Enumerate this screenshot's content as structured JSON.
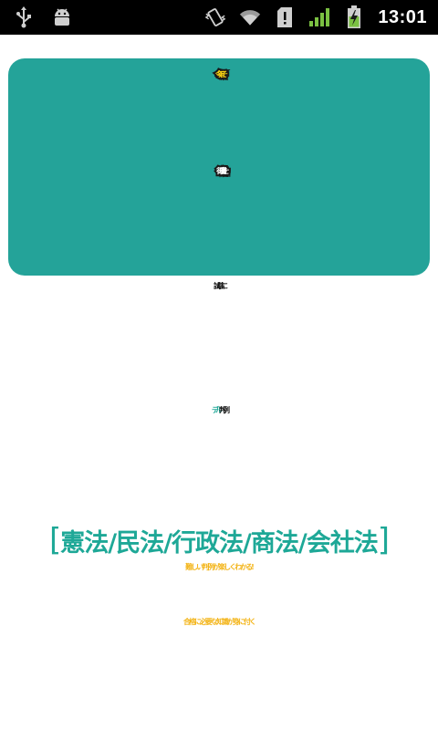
{
  "status_bar": {
    "time": "13:01",
    "icons": [
      "usb-icon",
      "android-debug-icon",
      "vibrate-icon",
      "wifi-icon",
      "sd-card-alert-icon",
      "signal-icon",
      "battery-charging-icon"
    ]
  },
  "splash": {
    "title_line1": "今年こそ",
    "title_line2": "行政書士!",
    "headline_line1": "試験に",
    "headline_line2_teal": "デル",
    "headline_line2_black": "判例",
    "subjects_open": "[",
    "subjects": "憲法/民法/行政法/商法/会社法",
    "subjects_close": "]",
    "tagline1": "難しい判例が楽しくわかる!",
    "tagline2": "合格に必要な知識が身に付く"
  },
  "colors": {
    "status_bar_bg": "#000000",
    "title_box": "#24a399",
    "title_yellow": "#f6cf12",
    "teal_text": "#1ea897",
    "orange_text": "#f3b417",
    "black_text": "#141414"
  }
}
